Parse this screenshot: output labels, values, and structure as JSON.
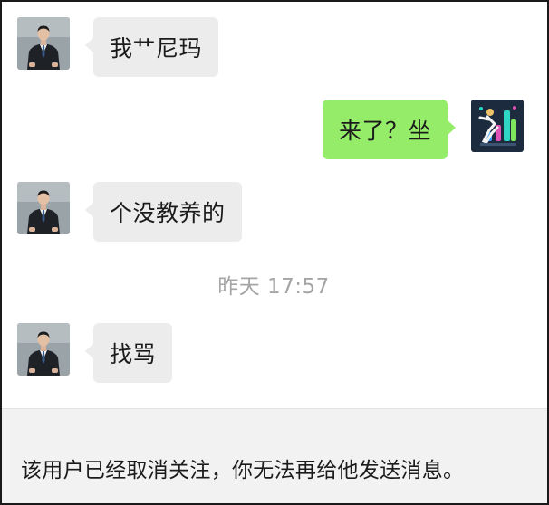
{
  "messages": [
    {
      "direction": "incoming",
      "text": "我艹尼玛",
      "avatar": "contact-avatar"
    },
    {
      "direction": "outgoing",
      "text": "来了？坐",
      "avatar": "own-avatar"
    },
    {
      "direction": "incoming",
      "text": "个没教养的",
      "avatar": "contact-avatar"
    },
    {
      "direction": "incoming",
      "text": "找骂",
      "avatar": "contact-avatar"
    }
  ],
  "timestamp": "昨天 17:57",
  "notice": "该用户已经取消关注，你无法再给他发送消息。",
  "colors": {
    "incoming_bubble": "#ececec",
    "outgoing_bubble": "#95ec69",
    "timestamp_text": "#a5a5a5",
    "notice_bar": "#f2f2f2"
  }
}
